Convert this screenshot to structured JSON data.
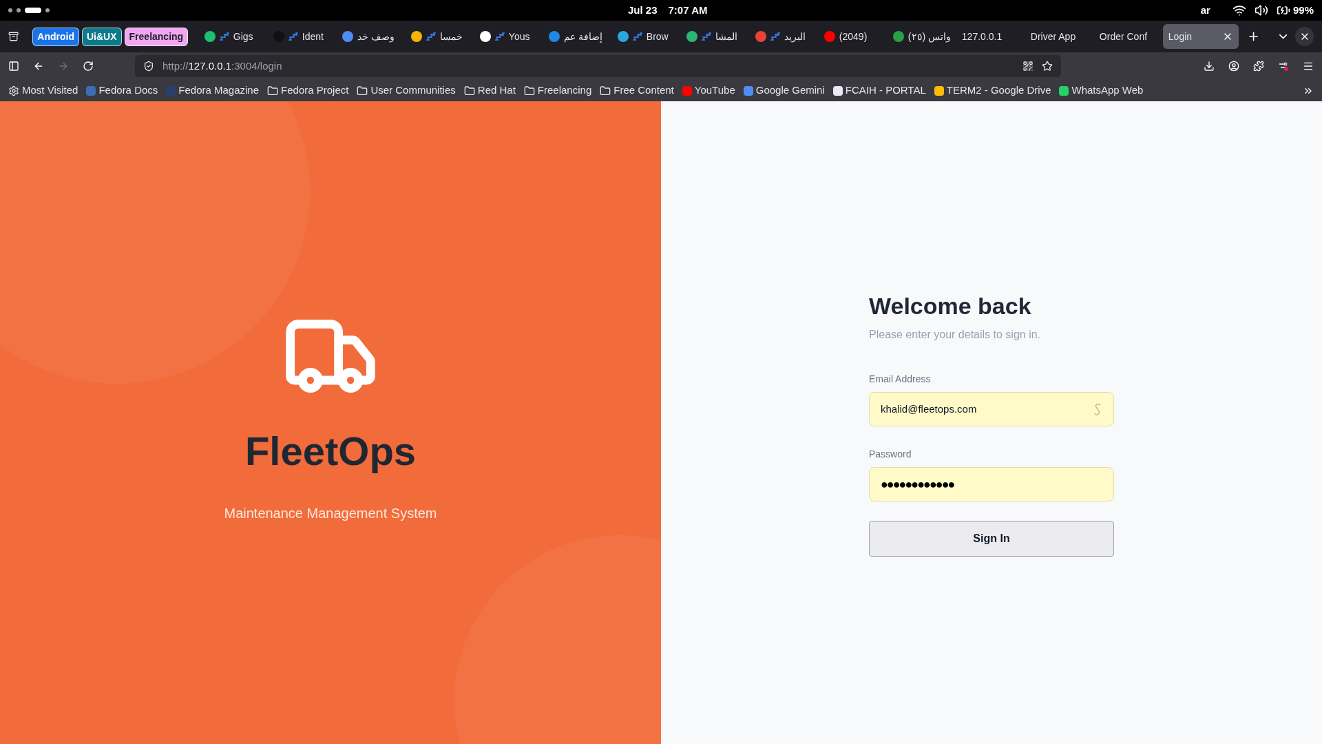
{
  "system_bar": {
    "date": "Jul 23",
    "time": "7:07 AM",
    "keyboard_layout": "ar",
    "battery": "99%"
  },
  "tab_groups": [
    {
      "label": "Android",
      "color": "#1a73e8"
    },
    {
      "label": "Ui&UX",
      "color": "#0b7a8a"
    },
    {
      "label": "Freelancing",
      "color": "#f0a6f0"
    }
  ],
  "tabs": [
    {
      "title": "Gigs",
      "color": "#1dbf73",
      "sleeping": true,
      "selected": false
    },
    {
      "title": "Ident",
      "color": "#111111",
      "sleeping": true,
      "selected": false
    },
    {
      "title": "وصف خد",
      "color": "#4f8df5",
      "sleeping": false,
      "selected": false
    },
    {
      "title": "خمسا",
      "color": "#f5b400",
      "sleeping": true,
      "selected": false
    },
    {
      "title": "Yous",
      "color": "#ffffff",
      "sleeping": true,
      "selected": false
    },
    {
      "title": "إضافة عم",
      "color": "#1e88e5",
      "sleeping": false,
      "selected": false
    },
    {
      "title": "Brow",
      "color": "#29a8e0",
      "sleeping": true,
      "selected": false
    },
    {
      "title": "المشا",
      "color": "#2bb673",
      "sleeping": true,
      "selected": false
    },
    {
      "title": "البريد",
      "color": "#ea4335",
      "sleeping": true,
      "selected": false
    },
    {
      "title": "(2049)",
      "color": "#ff0000",
      "sleeping": false,
      "selected": false
    },
    {
      "title": "(٢٥) واتس",
      "color": "#25a244",
      "sleeping": false,
      "selected": false
    },
    {
      "title": "127.0.0.1",
      "sleeping": false,
      "selected": false
    },
    {
      "title": "Driver App",
      "sleeping": false,
      "selected": false
    },
    {
      "title": "Order Conf",
      "sleeping": false,
      "selected": false
    },
    {
      "title": "Login",
      "sleeping": false,
      "selected": true
    }
  ],
  "address_bar": {
    "url_prefix": "http://",
    "url_host": "127.0.0.1",
    "url_rest": ":3004/login"
  },
  "bookmarks": [
    {
      "label": "Most Visited",
      "kind": "settings"
    },
    {
      "label": "Fedora Docs",
      "kind": "site",
      "color": "#3c6eb4"
    },
    {
      "label": "Fedora Magazine",
      "kind": "site",
      "color": "#294172"
    },
    {
      "label": "Fedora Project",
      "kind": "folder"
    },
    {
      "label": "User Communities",
      "kind": "folder"
    },
    {
      "label": "Red Hat",
      "kind": "folder"
    },
    {
      "label": "Freelancing",
      "kind": "folder"
    },
    {
      "label": "Free Content",
      "kind": "folder"
    },
    {
      "label": "YouTube",
      "kind": "site",
      "color": "#ff0000"
    },
    {
      "label": "Google Gemini",
      "kind": "site",
      "color": "#4f8df5"
    },
    {
      "label": "FCAIH - PORTAL",
      "kind": "site",
      "color": "#e8eaf6"
    },
    {
      "label": "TERM2 - Google Drive",
      "kind": "site",
      "color": "#fbbc04"
    },
    {
      "label": "WhatsApp Web",
      "kind": "site",
      "color": "#25d366"
    }
  ],
  "brand": {
    "name": "FleetOps",
    "tagline": "Maintenance Management System"
  },
  "login": {
    "heading": "Welcome back",
    "subheading": "Please enter your details to sign in.",
    "email": {
      "label": "Email Address",
      "value": "khalid@fleetops.com"
    },
    "password": {
      "label": "Password",
      "value": "●●●●●●●●●●●●"
    },
    "submit": "Sign In"
  }
}
